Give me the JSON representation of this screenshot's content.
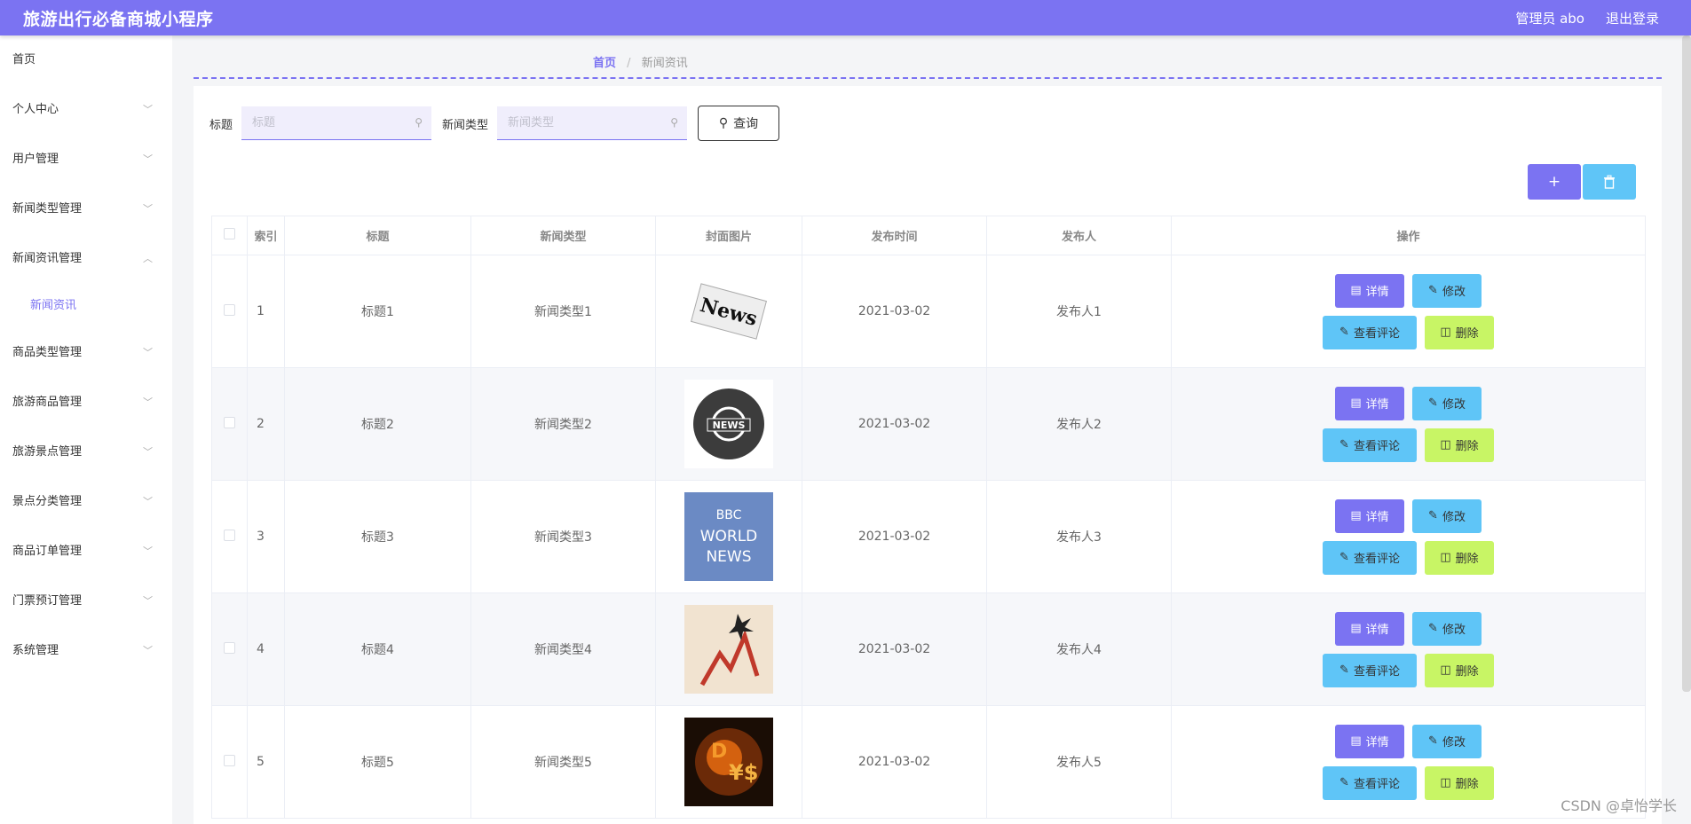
{
  "header": {
    "title": "旅游出行必备商城小程序",
    "user": "管理员 abo",
    "logout": "退出登录"
  },
  "sidebar": {
    "items": [
      {
        "label": "首页",
        "chevron": false
      },
      {
        "label": "个人中心",
        "chevron": true
      },
      {
        "label": "用户管理",
        "chevron": true
      },
      {
        "label": "新闻类型管理",
        "chevron": true
      },
      {
        "label": "新闻资讯管理",
        "chevron": true,
        "expanded": true
      },
      {
        "label": "商品类型管理",
        "chevron": true
      },
      {
        "label": "旅游商品管理",
        "chevron": true
      },
      {
        "label": "旅游景点管理",
        "chevron": true
      },
      {
        "label": "景点分类管理",
        "chevron": true
      },
      {
        "label": "商品订单管理",
        "chevron": true
      },
      {
        "label": "门票预订管理",
        "chevron": true
      },
      {
        "label": "系统管理",
        "chevron": true
      }
    ],
    "sub": "新闻资讯"
  },
  "breadcrumb": {
    "home": "首页",
    "sep": "/",
    "current": "新闻资讯"
  },
  "search": {
    "title_label": "标题",
    "title_placeholder": "标题",
    "type_label": "新闻类型",
    "type_placeholder": "新闻类型",
    "query_button": "查询"
  },
  "toolbar": {
    "add": "+",
    "delete_icon": "trash-icon"
  },
  "table": {
    "headers": [
      "索引",
      "标题",
      "新闻类型",
      "封面图片",
      "发布时间",
      "发布人",
      "操作"
    ],
    "rows": [
      {
        "index": "1",
        "title": "标题1",
        "type": "新闻类型1",
        "date": "2021-03-02",
        "author": "发布人1",
        "cover": "News"
      },
      {
        "index": "2",
        "title": "标题2",
        "type": "新闻类型2",
        "date": "2021-03-02",
        "author": "发布人2",
        "cover": "NEWS"
      },
      {
        "index": "3",
        "title": "标题3",
        "type": "新闻类型3",
        "date": "2021-03-02",
        "author": "发布人3",
        "cover": "BBC WORLD NEWS"
      },
      {
        "index": "4",
        "title": "标题4",
        "type": "新闻类型4",
        "date": "2021-03-02",
        "author": "发布人4",
        "cover": ""
      },
      {
        "index": "5",
        "title": "标题5",
        "type": "新闻类型5",
        "date": "2021-03-02",
        "author": "发布人5",
        "cover": ""
      }
    ],
    "actions": {
      "detail": "详情",
      "edit": "修改",
      "comments": "查看评论",
      "delete": "删除"
    }
  },
  "watermark": "CSDN @卓怡学长",
  "colors": {
    "primary": "#7b73f2",
    "info": "#5fc5f7",
    "danger": "#c8f565"
  }
}
